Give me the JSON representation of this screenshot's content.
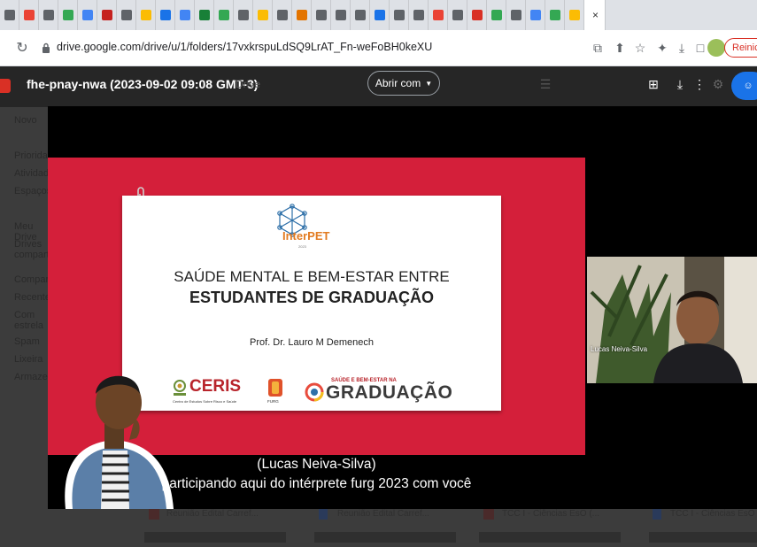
{
  "browser": {
    "url": "drive.google.com/drive/u/1/folders/17vxkrspuLdSQ9LrAT_Fn-weFoBH0keXU",
    "restart_label": "Reinic",
    "tab_colors": [
      "#5f6368",
      "#ea4335",
      "#5f6368",
      "#34a853",
      "#4285f4",
      "#c5221f",
      "#5f6368",
      "#fbbc04",
      "#1a73e8",
      "#4285f4",
      "#188038",
      "#34a853",
      "#5f6368",
      "#fbbc04",
      "#5f6368",
      "#e37400",
      "#5f6368",
      "#5f6368",
      "#5f6368",
      "#1a73e8",
      "#5f6368",
      "#5f6368",
      "#ea4335",
      "#5f6368",
      "#d93025",
      "#34a853",
      "#5f6368",
      "#4285f4",
      "#34a853",
      "#fbbc04"
    ]
  },
  "viewer": {
    "file_title": "fhe-pnay-nwa (2023-09-02 09:08 GMT-3)",
    "behind_title": "Drive",
    "open_with_label": "Abrir com",
    "sidebar_items": [
      "Novo",
      "Prioridade",
      "Atividade",
      "Espaços",
      "Meu Drive",
      "Drives compartilhados",
      "Compartilhados",
      "Recentes",
      "Com estrela",
      "Spam",
      "Lixeira",
      "Armazenamento"
    ],
    "background_files": [
      "Reunião Edital Carref...",
      "Reunião Edital Carref...",
      "TCC I - Ciências EsO (...",
      "TCC I - Ciências EsO (..."
    ]
  },
  "slide": {
    "logo": "InterPET",
    "logo_year": "2023",
    "title_line1": "SAÚDE MENTAL E BEM-ESTAR ENTRE",
    "title_line2": "ESTUDANTES DE GRADUAÇÃO",
    "author": "Prof. Dr. Lauro M Demenech",
    "ceris": "CERIS",
    "ceris_sub": "Centro de Estudos Sobre Risco e Saúde",
    "furg": "FURG",
    "grad_top": "SAÚDE E BEM-ESTAR NA",
    "grad": "GRADUAÇÃO"
  },
  "participant": {
    "name": "Lucas Neiva-Silva"
  },
  "captions": {
    "speaker": "(Lucas Neiva-Silva)",
    "text": "participando aqui do intérprete furg 2023 com você"
  }
}
